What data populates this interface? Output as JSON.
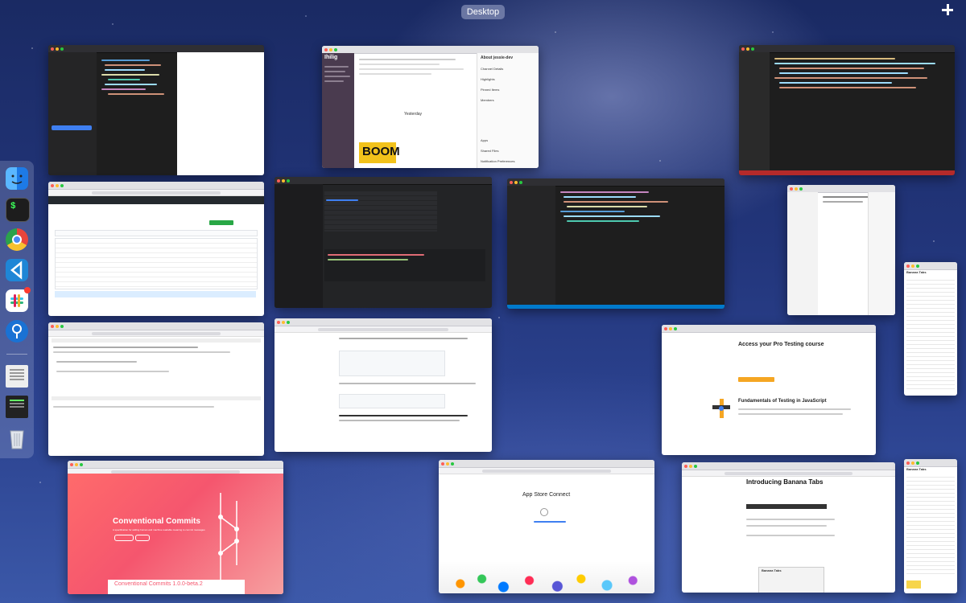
{
  "mission_control": {
    "space_label": "Desktop",
    "add_space_symbol": "+"
  },
  "dock": {
    "items": [
      {
        "name": "finder-icon",
        "color": "#2d8ff5"
      },
      {
        "name": "terminal-icon",
        "color": "#1d1d1d",
        "glyph": "$"
      },
      {
        "name": "chrome-icon",
        "color": "#e8453c"
      },
      {
        "name": "vscode-icon",
        "color": "#1f86d6"
      },
      {
        "name": "slack-icon",
        "color": "#4a154b"
      },
      {
        "name": "sourcetree-icon",
        "color": "#1a72d4"
      },
      {
        "name": "document-icon",
        "color": "#eeeeee"
      },
      {
        "name": "terminal-doc-icon",
        "color": "#222222"
      },
      {
        "name": "trash-icon",
        "color": "#d9dde5"
      }
    ]
  },
  "windows": {
    "slack": {
      "workspace": "Ihilig",
      "detail_title": "About jessie-dev",
      "detail_items": [
        "Channel Details",
        "Highlights",
        "Pinned Items",
        "Members",
        "Apps",
        "Shared Files",
        "Notification Preferences"
      ],
      "date_divider": "Yesterday",
      "meme_text": "BOOM"
    },
    "hp_app": {
      "heading": "Access your Pro Testing course",
      "subheading": "Fundamentals of Testing in JavaScript"
    },
    "conventional_commits": {
      "title": "Conventional Commits",
      "subtitle": "A specification for adding human and machine readable meaning to commit messages",
      "footer": "Conventional Commits 1.0.0-beta.2"
    },
    "app_store_connect": {
      "title": "App Store Connect"
    },
    "banana_blog": {
      "title": "Introducing Banana Tabs",
      "panel_title": "Banana Tabs"
    },
    "banana_side_top": {
      "title": "Banana Tabs"
    },
    "banana_side_bottom": {
      "title": "Banana Tabs"
    }
  }
}
